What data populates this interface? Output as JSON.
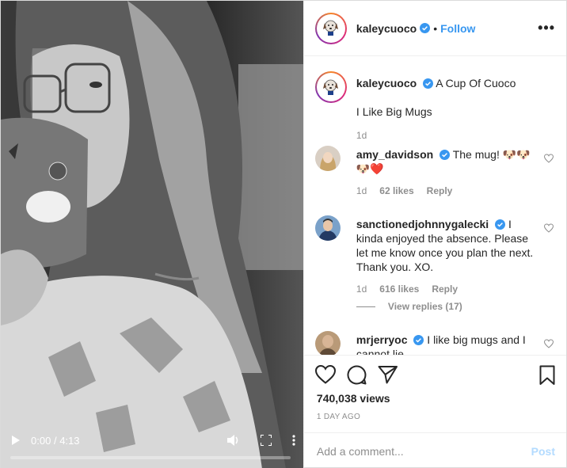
{
  "video": {
    "time_current": "0:00",
    "time_separator": "/",
    "time_total": "4:13",
    "progress": 0.0
  },
  "header": {
    "username": "kaleycuoco",
    "separator": "•",
    "follow_label": "Follow",
    "more_label": "•••"
  },
  "caption": {
    "username": "kaleycuoco",
    "line1": "A Cup Of Cuoco",
    "line2": "I Like Big Mugs",
    "age": "1d"
  },
  "comments": [
    {
      "username": "amy_davidson",
      "text": "The mug! 🐶🐶🐶❤️",
      "age": "1d",
      "likes": "62 likes",
      "reply_label": "Reply"
    },
    {
      "username": "sanctionedjohnnygalecki",
      "text": "I kinda enjoyed the absence. Please let me know once you plan the next. Thank you. XO.",
      "age": "1d",
      "likes": "616 likes",
      "reply_label": "Reply",
      "view_replies": "View replies (17)"
    },
    {
      "username": "mrjerryoc",
      "text": "I like big mugs and I cannot lie"
    }
  ],
  "actions": {
    "views": "740,038 views",
    "posted": "1 DAY AGO"
  },
  "add_comment": {
    "placeholder": "Add a comment...",
    "post_label": "Post"
  },
  "colors": {
    "accent": "#3897f0",
    "verified": "#3897f0",
    "heart_red": "#ed4956",
    "post_disabled": "#b3dbff"
  }
}
